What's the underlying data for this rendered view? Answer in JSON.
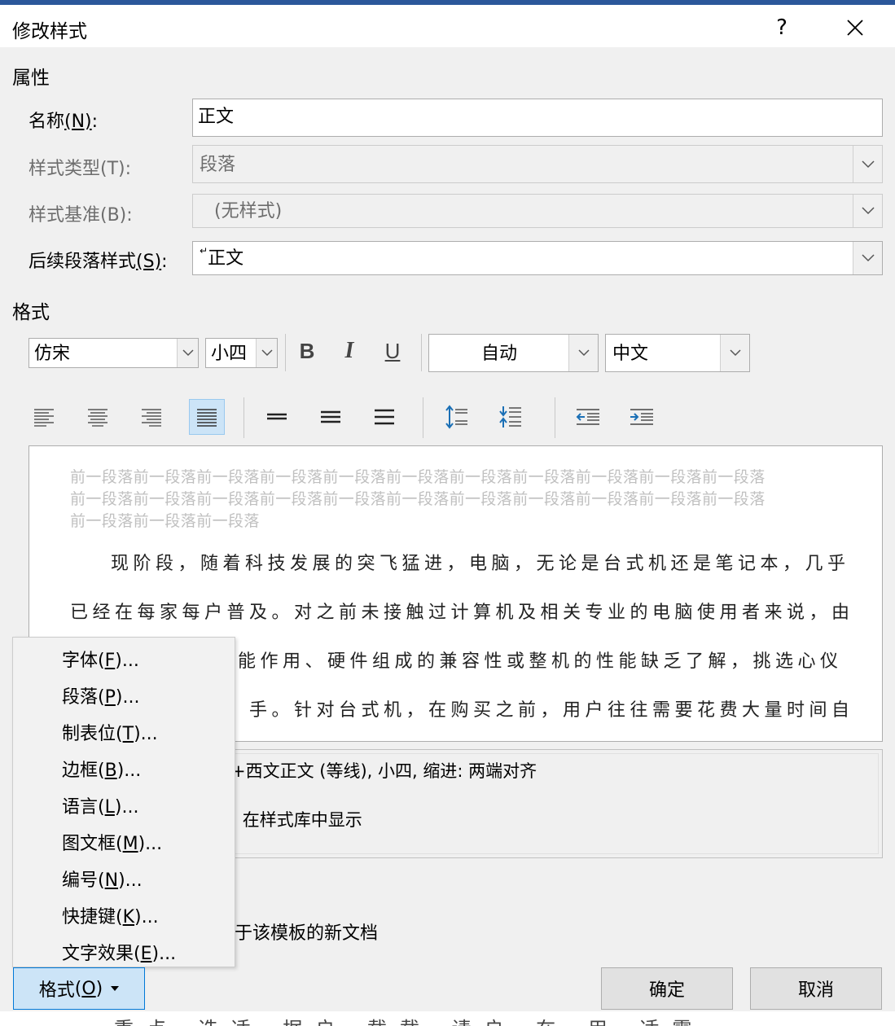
{
  "dialog": {
    "title": "修改样式",
    "help_label": "?",
    "close_label": "×"
  },
  "properties": {
    "section_title": "属性",
    "name_label": "名称",
    "name_mnemonic": "(N)",
    "name_suffix": ":",
    "name_value": "正文",
    "style_type_label": "样式类型(T):",
    "style_type_value": "段落",
    "style_based_label": "样式基准(B):",
    "style_based_value": "(无样式)",
    "following_label": "后续段落样式",
    "following_mnemonic": "(S)",
    "following_suffix": ":",
    "following_value": "正文",
    "following_mark": "↵"
  },
  "format_section": {
    "section_title": "格式",
    "font_value": "仿宋",
    "size_value": "小四",
    "bold_label": "B",
    "italic_label": "I",
    "underline_label": "U",
    "color_value": "自动",
    "script_value": "中文"
  },
  "preview": {
    "prev_lines": [
      "前一段落前一段落前一段落前一段落前一段落前一段落前一段落前一段落前一段落前一段落前一段落",
      "前一段落前一段落前一段落前一段落前一段落前一段落前一段落前一段落前一段落前一段落前一段落",
      "前一段落前一段落前一段落"
    ],
    "body_lines": [
      "现阶段，随着科技发展的突飞猛进，电脑，无论是台式机还是笔记本，几乎",
      "已经在每家每户普及。对之前未接触过计算机及相关专业的电脑使用者来说，由",
      "能作用、硬件组成的兼容性或整机的性能缺乏了解，挑选心仪",
      "手。针对台式机，在购买之前，用户往往需要花费大量时间自"
    ]
  },
  "description": {
    "line1": "+西文正文 (等线), 小四, 缩进: 两端对齐",
    "line2": ": 在样式库中显示"
  },
  "options": {
    "template_text": "于该模板的新文档"
  },
  "format_menu": {
    "items": [
      {
        "label": "字体",
        "key": "F"
      },
      {
        "label": "段落",
        "key": "P"
      },
      {
        "label": "制表位",
        "key": "T"
      },
      {
        "label": "边框",
        "key": "B"
      },
      {
        "label": "语言",
        "key": "L"
      },
      {
        "label": "图文框",
        "key": "M"
      },
      {
        "label": "编号",
        "key": "N"
      },
      {
        "label": "快捷键",
        "key": "K"
      },
      {
        "label": "文字效果",
        "key": "E"
      }
    ]
  },
  "buttons": {
    "format_label": "格式",
    "format_key": "O",
    "ok_label": "确定",
    "cancel_label": "取消"
  },
  "underlying": {
    "bottom_text": "重点 选适 据户 载载 请户 在 用 适霸"
  },
  "colors": {
    "accent": "#0078d7",
    "active_bg": "#cce4f7",
    "dialog_bg": "#f0f0f0"
  }
}
